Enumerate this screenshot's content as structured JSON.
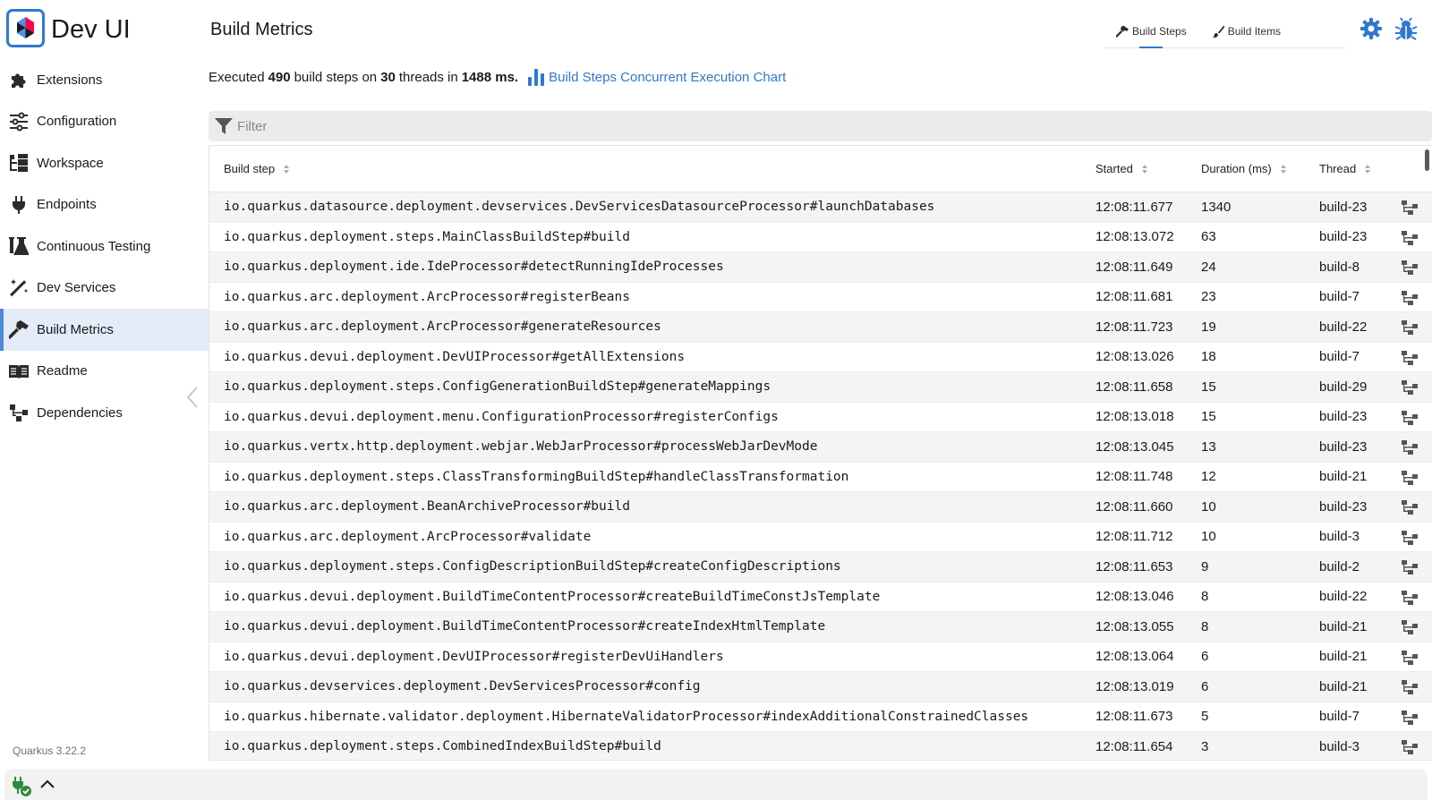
{
  "app": {
    "title": "Dev UI",
    "version": "Quarkus 3.22.2"
  },
  "sidebar": {
    "items": [
      {
        "label": "Extensions",
        "icon": "puzzle-icon"
      },
      {
        "label": "Configuration",
        "icon": "sliders-icon"
      },
      {
        "label": "Workspace",
        "icon": "folder-tree-icon"
      },
      {
        "label": "Endpoints",
        "icon": "plug-icon"
      },
      {
        "label": "Continuous Testing",
        "icon": "flask-icon"
      },
      {
        "label": "Dev Services",
        "icon": "magic-wand-icon"
      },
      {
        "label": "Build Metrics",
        "icon": "hammer-icon",
        "active": true
      },
      {
        "label": "Readme",
        "icon": "book-icon"
      },
      {
        "label": "Dependencies",
        "icon": "diagram-icon"
      }
    ]
  },
  "header": {
    "title": "Build Metrics",
    "tabs": [
      {
        "label": "Build Steps",
        "active": true
      },
      {
        "label": "Build Items",
        "active": false
      }
    ]
  },
  "summary": {
    "prefix": "Executed",
    "steps": "490",
    "middle1": "build steps on",
    "threads": "30",
    "middle2": "threads in",
    "duration": "1488 ms.",
    "chart_link": "Build Steps Concurrent Execution Chart"
  },
  "filter": {
    "placeholder": "Filter"
  },
  "table": {
    "columns": {
      "step": "Build step",
      "started": "Started",
      "duration": "Duration (ms)",
      "thread": "Thread"
    },
    "rows": [
      {
        "step": "io.quarkus.datasource.deployment.devservices.DevServicesDatasourceProcessor#launchDatabases",
        "started": "12:08:11.677",
        "duration": "1340",
        "thread": "build-23"
      },
      {
        "step": "io.quarkus.deployment.steps.MainClassBuildStep#build",
        "started": "12:08:13.072",
        "duration": "63",
        "thread": "build-23"
      },
      {
        "step": "io.quarkus.deployment.ide.IdeProcessor#detectRunningIdeProcesses",
        "started": "12:08:11.649",
        "duration": "24",
        "thread": "build-8"
      },
      {
        "step": "io.quarkus.arc.deployment.ArcProcessor#registerBeans",
        "started": "12:08:11.681",
        "duration": "23",
        "thread": "build-7"
      },
      {
        "step": "io.quarkus.arc.deployment.ArcProcessor#generateResources",
        "started": "12:08:11.723",
        "duration": "19",
        "thread": "build-22"
      },
      {
        "step": "io.quarkus.devui.deployment.DevUIProcessor#getAllExtensions",
        "started": "12:08:13.026",
        "duration": "18",
        "thread": "build-7"
      },
      {
        "step": "io.quarkus.deployment.steps.ConfigGenerationBuildStep#generateMappings",
        "started": "12:08:11.658",
        "duration": "15",
        "thread": "build-29"
      },
      {
        "step": "io.quarkus.devui.deployment.menu.ConfigurationProcessor#registerConfigs",
        "started": "12:08:13.018",
        "duration": "15",
        "thread": "build-23"
      },
      {
        "step": "io.quarkus.vertx.http.deployment.webjar.WebJarProcessor#processWebJarDevMode",
        "started": "12:08:13.045",
        "duration": "13",
        "thread": "build-23"
      },
      {
        "step": "io.quarkus.deployment.steps.ClassTransformingBuildStep#handleClassTransformation",
        "started": "12:08:11.748",
        "duration": "12",
        "thread": "build-21"
      },
      {
        "step": "io.quarkus.arc.deployment.BeanArchiveProcessor#build",
        "started": "12:08:11.660",
        "duration": "10",
        "thread": "build-23"
      },
      {
        "step": "io.quarkus.arc.deployment.ArcProcessor#validate",
        "started": "12:08:11.712",
        "duration": "10",
        "thread": "build-3"
      },
      {
        "step": "io.quarkus.deployment.steps.ConfigDescriptionBuildStep#createConfigDescriptions",
        "started": "12:08:11.653",
        "duration": "9",
        "thread": "build-2"
      },
      {
        "step": "io.quarkus.devui.deployment.BuildTimeContentProcessor#createBuildTimeConstJsTemplate",
        "started": "12:08:13.046",
        "duration": "8",
        "thread": "build-22"
      },
      {
        "step": "io.quarkus.devui.deployment.BuildTimeContentProcessor#createIndexHtmlTemplate",
        "started": "12:08:13.055",
        "duration": "8",
        "thread": "build-21"
      },
      {
        "step": "io.quarkus.devui.deployment.DevUIProcessor#registerDevUiHandlers",
        "started": "12:08:13.064",
        "duration": "6",
        "thread": "build-21"
      },
      {
        "step": "io.quarkus.devservices.deployment.DevServicesProcessor#config",
        "started": "12:08:13.019",
        "duration": "6",
        "thread": "build-21"
      },
      {
        "step": "io.quarkus.hibernate.validator.deployment.HibernateValidatorProcessor#indexAdditionalConstrainedClasses",
        "started": "12:08:11.673",
        "duration": "5",
        "thread": "build-7"
      },
      {
        "step": "io.quarkus.deployment.steps.CombinedIndexBuildStep#build",
        "started": "12:08:11.654",
        "duration": "3",
        "thread": "build-3"
      }
    ]
  },
  "colors": {
    "accent": "#2f78d0",
    "active_bg": "#e3ecf8",
    "success": "#2e8b3a"
  }
}
